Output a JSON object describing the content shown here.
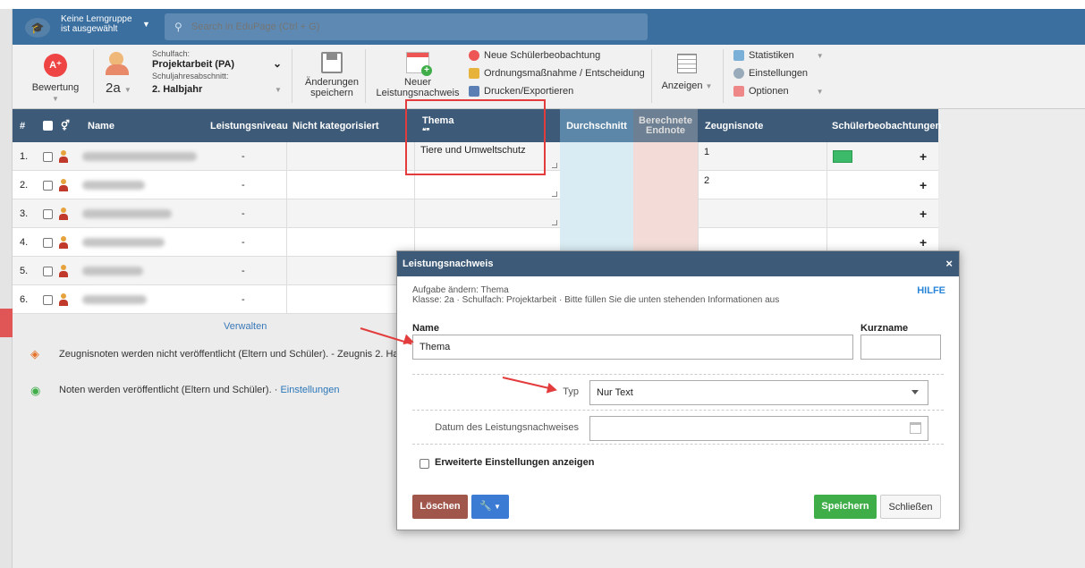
{
  "topbar": {
    "group_line1": "Keine Lerngruppe",
    "group_line2": "ist ausgewählt",
    "search_placeholder": "Search in EduPage (Ctrl + G)"
  },
  "toolbar": {
    "bewertung": "Bewertung",
    "schulfach_label": "Schulfach:",
    "schulfach_value": "Projektarbeit (PA)",
    "class_value": "2a",
    "schuljahresabschnitt_label": "Schuljahresabschnitt:",
    "schuljahresabschnitt_value": "2. Halbjahr",
    "aenderungen_line1": "Änderungen",
    "aenderungen_line2": "speichern",
    "neuer_line1": "Neuer",
    "neuer_line2": "Leistungsnachweis",
    "neue_beobachtung": "Neue Schülerbeobachtung",
    "ordnung": "Ordnungsmaßnahme / Entscheidung",
    "drucken": "Drucken/Exportieren",
    "anzeigen": "Anzeigen",
    "statistiken": "Statistiken",
    "einstellungen": "Einstellungen",
    "optionen": "Optionen"
  },
  "table": {
    "headers": {
      "num": "#",
      "name": "Name",
      "leistungsniveau": "Leistungsniveau",
      "nicht_kategorisiert": "Nicht kategorisiert",
      "thema": "Thema",
      "thema_quote": "❝❞",
      "durchschnitt": "Durchschnitt",
      "berechnete_line1": "Berechnete",
      "berechnete_line2": "Endnote",
      "zeugnisnote": "Zeugnisnote",
      "schuelerbeobachtungen": "Schülerbeobachtungen"
    },
    "rows": [
      {
        "num": "1.",
        "niveau": "-",
        "thema": "Tiere und Umweltschutz",
        "zeugnisnote": "1"
      },
      {
        "num": "2.",
        "niveau": "-",
        "thema": "",
        "zeugnisnote": "2"
      },
      {
        "num": "3.",
        "niveau": "-",
        "thema": "",
        "zeugnisnote": ""
      },
      {
        "num": "4.",
        "niveau": "-",
        "thema": "",
        "zeugnisnote": ""
      },
      {
        "num": "5.",
        "niveau": "-",
        "thema": "",
        "zeugnisnote": ""
      },
      {
        "num": "6.",
        "niveau": "-",
        "thema": "",
        "zeugnisnote": ""
      }
    ],
    "plus": "+"
  },
  "below": {
    "verwalten": "Verwalten",
    "note1": "Zeugnisnoten werden nicht veröffentlicht (Eltern und Schüler). - Zeugnis 2. Hal",
    "note2": "Noten werden veröffentlicht (Eltern und Schüler). ·",
    "note2_link": "Einstellungen"
  },
  "dialog": {
    "title": "Leistungsnachweis",
    "close": "×",
    "sub1": "Aufgabe ändern: Thema",
    "sub2": "Klasse: 2a · Schulfach: Projektarbeit · Bitte füllen Sie die unten stehenden Informationen aus",
    "hilfe": "HILFE",
    "name_label": "Name",
    "name_value": "Thema",
    "kurzname_label": "Kurzname",
    "kurzname_value": "",
    "typ_label": "Typ",
    "typ_value": "Nur Text",
    "datum_label": "Datum des Leistungsnachweises",
    "erweitert": "Erweiterte Einstellungen anzeigen",
    "loeschen": "Löschen",
    "speichern": "Speichern",
    "schliessen": "Schließen"
  },
  "colors": {
    "header_blue": "#3d5a78",
    "topbar_blue": "#3a6fa0",
    "durchschnitt_bg": "#d9ecf3",
    "endnote_bg": "#f3dcd8",
    "danger": "#a0564b",
    "primary": "#3b7bd4",
    "success": "#3fae49",
    "annotation_red": "#e23c3c"
  }
}
